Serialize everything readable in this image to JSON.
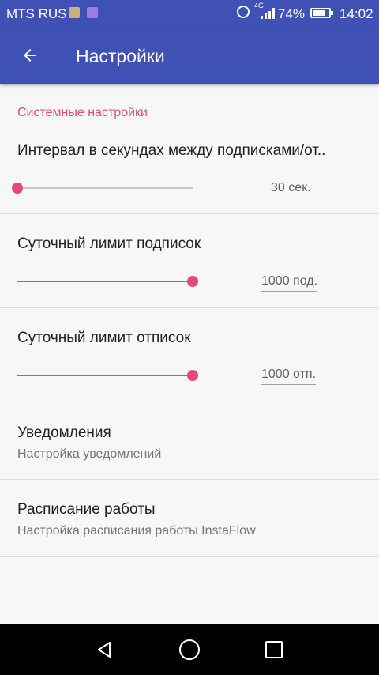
{
  "status_bar": {
    "carrier": "MTS RUS",
    "network_badge": "4G",
    "battery_percent": "74%",
    "battery_level": 0.74,
    "time": "14:02"
  },
  "app_bar": {
    "title": "Настройки"
  },
  "section": {
    "header": "Системные настройки"
  },
  "preferences": {
    "interval": {
      "title": "Интервал в секундах между подписками/от..",
      "value_label": "30 сек.",
      "level": 0.0
    },
    "daily_follow_limit": {
      "title": "Суточный лимит подписок",
      "value_label": "1000 под.",
      "level": 1.0
    },
    "daily_unfollow_limit": {
      "title": "Суточный лимит отписок",
      "value_label": "1000 отп.",
      "level": 1.0
    },
    "notifications": {
      "title": "Уведомления",
      "summary": "Настройка уведомлений"
    },
    "schedule": {
      "title": "Расписание работы",
      "summary": "Настройка расписания работы InstaFlow"
    }
  },
  "colors": {
    "primary": "#3f51b5",
    "accent": "#e8467c"
  },
  "icons": {
    "back": "arrow-left-icon",
    "nav_back": "triangle-back-icon",
    "nav_home": "circle-home-icon",
    "nav_recent": "square-recent-icon"
  }
}
